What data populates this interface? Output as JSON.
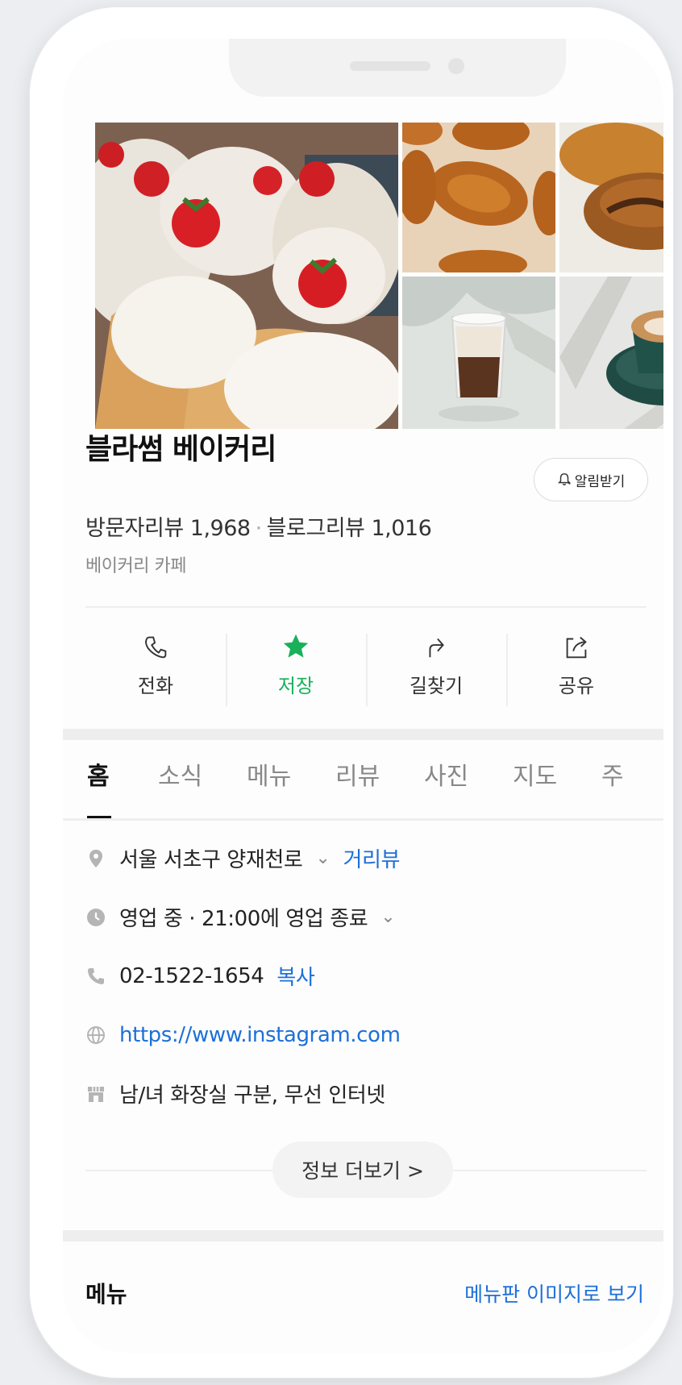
{
  "place": {
    "name": "블라썸 베이커리",
    "notify_label": "알림받기",
    "visitor_reviews": "방문자리뷰 1,968",
    "separator": "·",
    "blog_reviews": "블로그리뷰 1,016",
    "category": "베이커리 카페"
  },
  "actions": [
    {
      "label": "전화",
      "icon": "phone-icon"
    },
    {
      "label": "저장",
      "icon": "star-icon"
    },
    {
      "label": "길찾기",
      "icon": "directions-icon"
    },
    {
      "label": "공유",
      "icon": "share-icon"
    }
  ],
  "tabs": [
    "홈",
    "소식",
    "메뉴",
    "리뷰",
    "사진",
    "지도",
    "주"
  ],
  "active_tab": "홈",
  "info": {
    "address": "서울 서초구 양재천로",
    "address_link": "거리뷰",
    "hours": "영업 중 · 21:00에 영업 종료",
    "phone": "02-1522-1654",
    "phone_copy": "복사",
    "website": "https://www.instagram.com",
    "amenities": "남/녀 화장실 구분, 무선 인터넷"
  },
  "more_info_label": "정보 더보기 >",
  "menu_section": {
    "title": "메뉴",
    "link": "메뉴판 이미지로 보기"
  },
  "colors": {
    "accent_green": "#18b15a",
    "link_blue": "#1d6fd8"
  }
}
